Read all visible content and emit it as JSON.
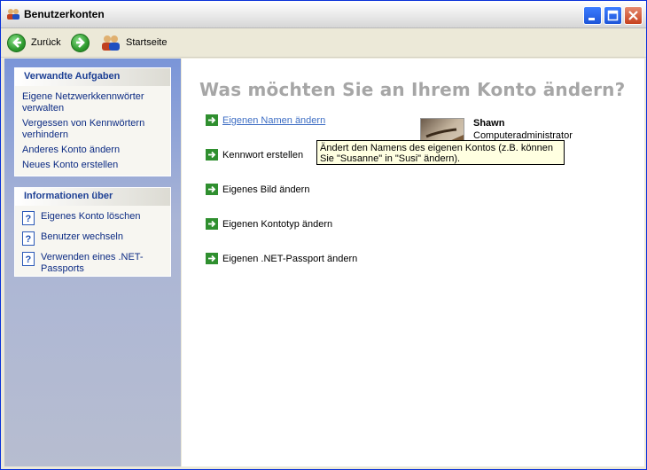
{
  "window": {
    "title": "Benutzerkonten",
    "app_icon": "users-icon",
    "controls": [
      "minimize-icon",
      "maximize-icon",
      "close-icon"
    ]
  },
  "toolbar": {
    "back_label": "Zurück",
    "forward_icon": "forward-arrow-icon",
    "home_label": "Startseite"
  },
  "left_pane": {
    "related_tasks": {
      "title": "Verwandte Aufgaben",
      "items": [
        "Eigene Netzwerkkennwörter verwalten",
        "Vergessen von Kennwörtern verhindern",
        "Anderes Konto ändern",
        "Neues Konto erstellen"
      ]
    },
    "info": {
      "title": "Informationen über",
      "items": [
        "Eigenes Konto löschen",
        "Benutzer wechseln",
        "Verwenden eines .NET-Passports"
      ]
    }
  },
  "main": {
    "heading": "Was möchten Sie an Ihrem Konto ändern?",
    "options": [
      "Eigenen Namen ändern",
      "Kennwort erstellen",
      "Eigenes Bild ändern",
      "Eigenen Kontotyp ändern",
      "Eigenen .NET-Passport ändern"
    ],
    "user": {
      "name": "Shawn",
      "role": "Computeradministrator"
    },
    "tooltip": "Ändert den Namens des eigenen Kontos (z.B. können Sie \"Susanne\" in \"Susi\" ändern)."
  },
  "colors": {
    "accent": "#0831d9",
    "link": "#0c2b83",
    "heading": "#a6a6a6",
    "tooltip_bg": "#ffffe1"
  }
}
